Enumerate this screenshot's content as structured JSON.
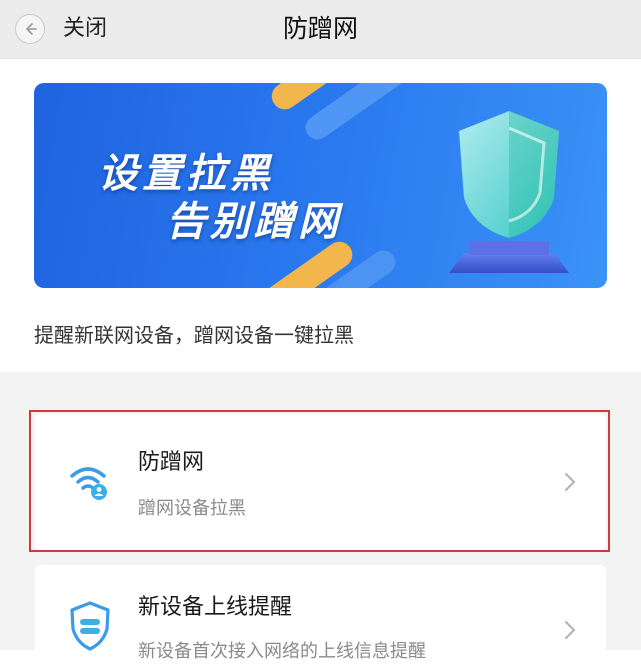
{
  "header": {
    "close_label": "关闭",
    "title": "防蹭网"
  },
  "banner": {
    "line1": "设置拉黑",
    "line2": "告别蹭网"
  },
  "subtitle": "提醒新联网设备，蹭网设备一键拉黑",
  "cards": [
    {
      "title": "防蹭网",
      "desc": "蹭网设备拉黑",
      "icon": "wifi-user-icon"
    },
    {
      "title": "新设备上线提醒",
      "desc": "新设备首次接入网络的上线信息提醒",
      "icon": "shield-icon"
    }
  ],
  "colors": {
    "accent": "#2b7fe8",
    "highlight": "#cc3a3a"
  }
}
